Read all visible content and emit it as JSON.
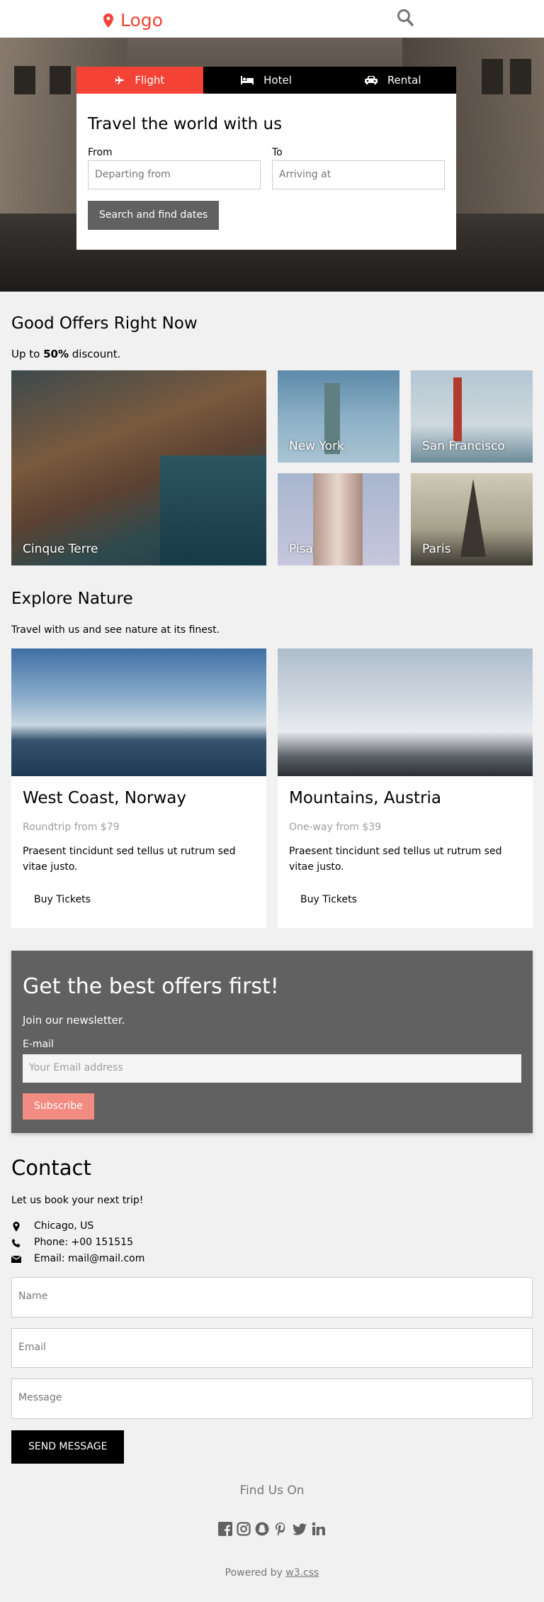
{
  "header": {
    "logo_text": "Logo",
    "accent_color": "#f44336"
  },
  "booking": {
    "tabs": [
      {
        "label": "Flight",
        "icon": "plane-icon",
        "active": true
      },
      {
        "label": "Hotel",
        "icon": "bed-icon",
        "active": false
      },
      {
        "label": "Rental",
        "icon": "car-icon",
        "active": false
      }
    ],
    "title": "Travel the world with us",
    "from_label": "From",
    "from_placeholder": "Departing from",
    "to_label": "To",
    "to_placeholder": "Arriving at",
    "search_button": "Search and find dates"
  },
  "offers": {
    "title": "Good Offers Right Now",
    "subtitle_pre": "Up to ",
    "subtitle_bold": "50%",
    "subtitle_post": " discount.",
    "tiles": [
      {
        "label": "Cinque Terre"
      },
      {
        "label": "New York"
      },
      {
        "label": "San Francisco"
      },
      {
        "label": "Pisa"
      },
      {
        "label": "Paris"
      }
    ]
  },
  "nature": {
    "title": "Explore Nature",
    "subtitle": "Travel with us and see nature at its finest.",
    "cards": [
      {
        "title": "West Coast, Norway",
        "price": "Roundtrip from $79",
        "desc": "Praesent tincidunt sed tellus ut rutrum sed vitae justo.",
        "button": "Buy Tickets"
      },
      {
        "title": "Mountains, Austria",
        "price": "One-way from $39",
        "desc": "Praesent tincidunt sed tellus ut rutrum sed vitae justo.",
        "button": "Buy Tickets"
      }
    ]
  },
  "newsletter": {
    "title": "Get the best offers first!",
    "subtitle": "Join our newsletter.",
    "email_label": "E-mail",
    "email_placeholder": "Your Email address",
    "button": "Subscribe"
  },
  "contact": {
    "title": "Contact",
    "subtitle": "Let us book your next trip!",
    "location": "Chicago, US",
    "phone": "Phone: +00 151515",
    "email": "Email: mail@mail.com",
    "name_placeholder": "Name",
    "email_placeholder": "Email",
    "message_placeholder": "Message",
    "send_button": "SEND MESSAGE"
  },
  "footer": {
    "find_us": "Find Us On",
    "powered_pre": "Powered by ",
    "powered_link": "w3.css"
  }
}
